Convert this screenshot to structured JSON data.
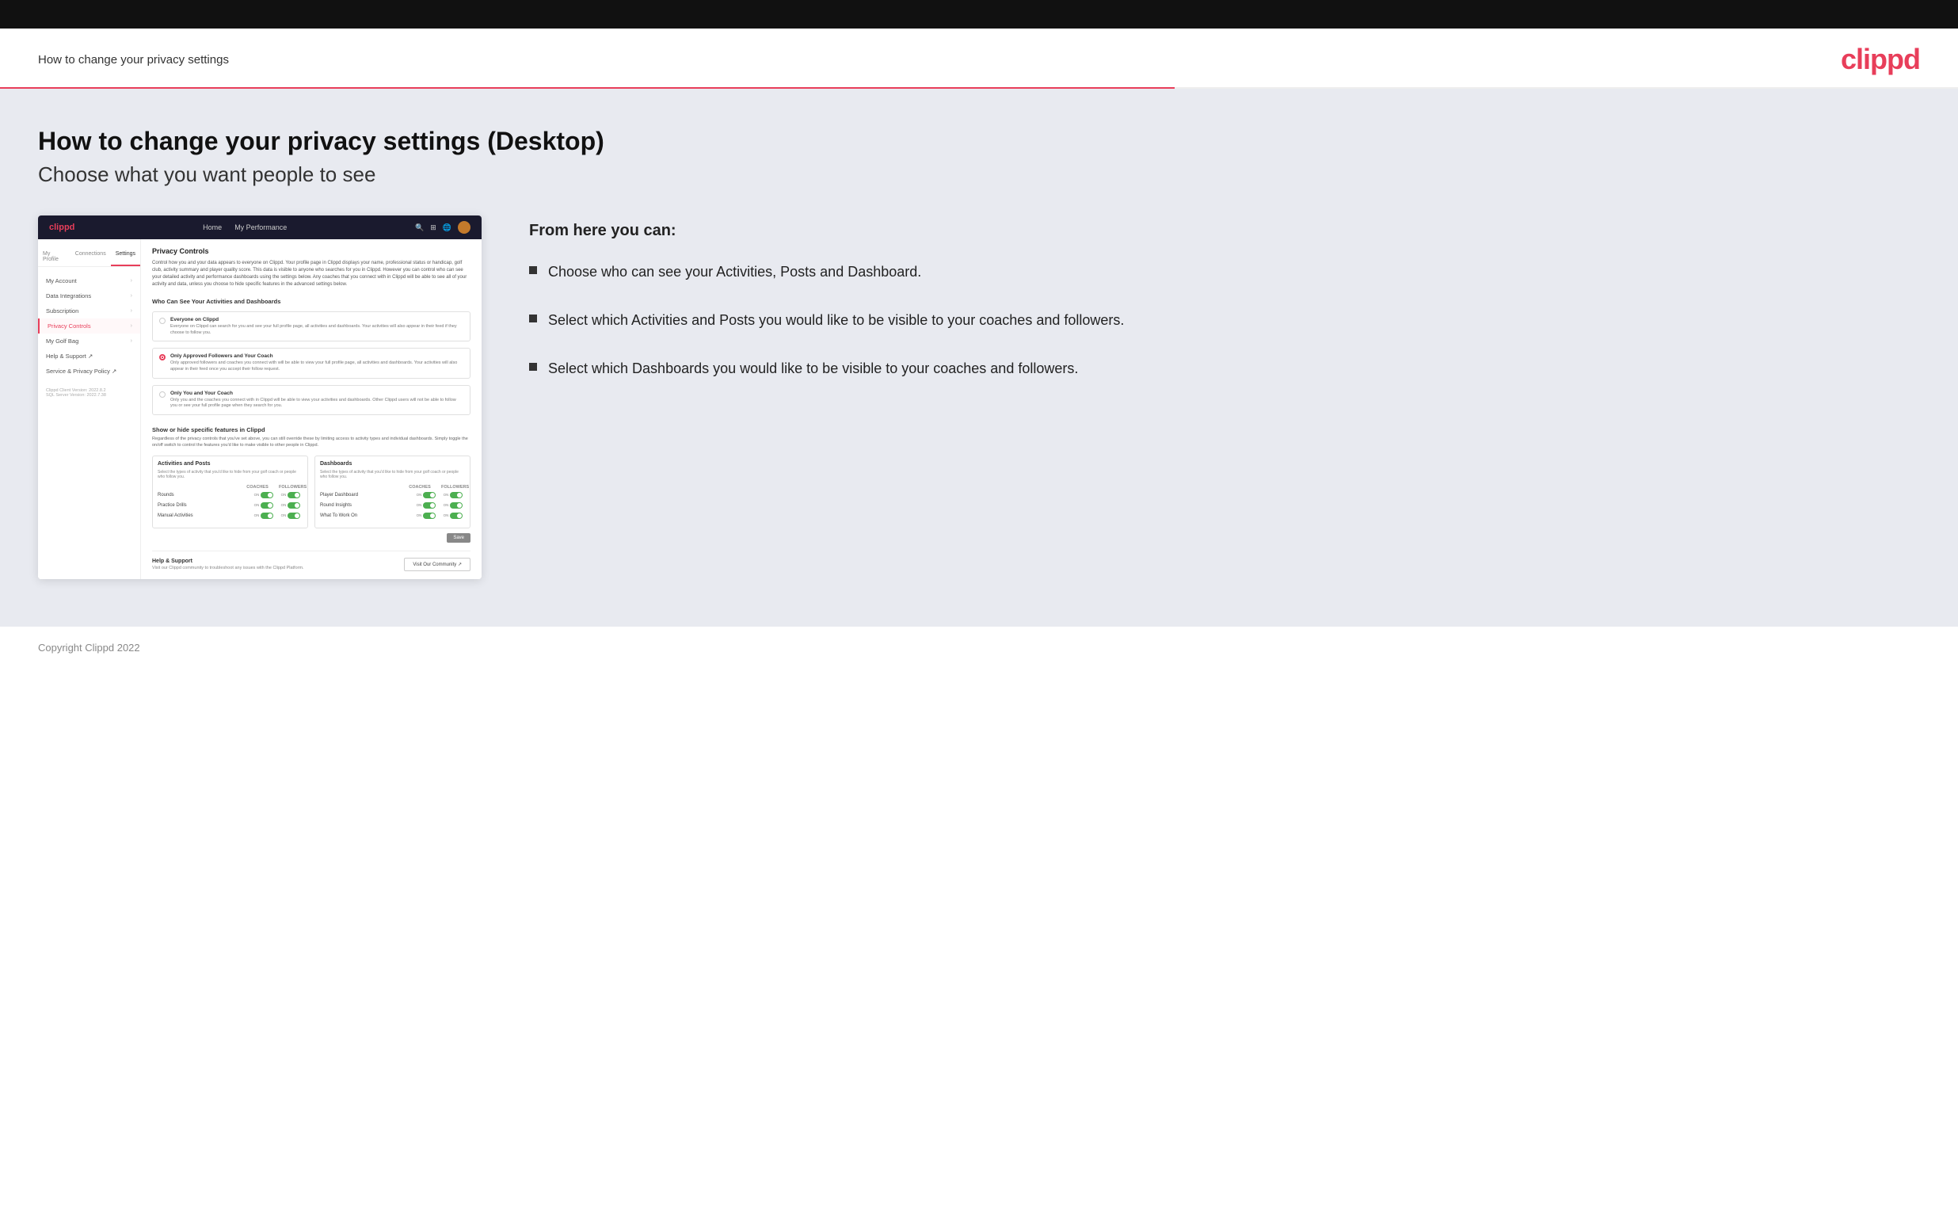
{
  "header": {
    "title": "How to change your privacy settings",
    "logo": "clippd"
  },
  "page": {
    "heading": "How to change your privacy settings (Desktop)",
    "subheading": "Choose what you want people to see"
  },
  "right_panel": {
    "from_here_label": "From here you can:",
    "bullets": [
      "Choose who can see your Activities, Posts and Dashboard.",
      "Select which Activities and Posts you would like to be visible to your coaches and followers.",
      "Select which Dashboards you would like to be visible to your coaches and followers."
    ]
  },
  "mockup": {
    "nav": {
      "logo": "clippd",
      "links": [
        "Home",
        "My Performance"
      ],
      "icons": [
        "search",
        "grid",
        "globe",
        "avatar"
      ]
    },
    "sidebar": {
      "tabs": [
        "My Profile",
        "Connections",
        "Settings"
      ],
      "items": [
        {
          "label": "My Account",
          "active": false
        },
        {
          "label": "Data Integrations",
          "active": false
        },
        {
          "label": "Subscription",
          "active": false
        },
        {
          "label": "Privacy Controls",
          "active": true
        },
        {
          "label": "My Golf Bag",
          "active": false
        },
        {
          "label": "Help & Support ↗",
          "active": false
        },
        {
          "label": "Service & Privacy Policy ↗",
          "active": false
        }
      ],
      "version": "Clippd Client Version: 2022.8.2\nSQL Server Version: 2022.7.38"
    },
    "main": {
      "section_title": "Privacy Controls",
      "description": "Control how you and your data appears to everyone on Clippd. Your profile page in Clippd displays your name, professional status or handicap, golf club, activity summary and player quality score. This data is visible to anyone who searches for you in Clippd. However you can control who can see your detailed activity and performance dashboards using the settings below. Any coaches that you connect with in Clippd will be able to see all of your activity and data, unless you choose to hide specific features in the advanced settings below.",
      "who_can_see_title": "Who Can See Your Activities and Dashboards",
      "radio_options": [
        {
          "label": "Everyone on Clippd",
          "description": "Everyone on Clippd can search for you and see your full profile page, all activities and dashboards. Your activities will also appear in their feed if they choose to follow you.",
          "selected": false
        },
        {
          "label": "Only Approved Followers and Your Coach",
          "description": "Only approved followers and coaches you connect with will be able to view your full profile page, all activities and dashboards. Your activities will also appear in their feed once you accept their follow request.",
          "selected": true
        },
        {
          "label": "Only You and Your Coach",
          "description": "Only you and the coaches you connect with in Clippd will be able to view your activities and dashboards. Other Clippd users will not be able to follow you or see your full profile page when they search for you.",
          "selected": false
        }
      ],
      "show_hide_title": "Show or hide specific features in Clippd",
      "show_hide_desc": "Regardless of the privacy controls that you've set above, you can still override these by limiting access to activity types and individual dashboards. Simply toggle the on/off switch to control the features you'd like to make visible to other people in Clippd.",
      "activities_panel": {
        "title": "Activities and Posts",
        "desc": "Select the types of activity that you'd like to hide from your golf coach or people who follow you.",
        "rows": [
          {
            "name": "Rounds",
            "coaches_on": true,
            "followers_on": true
          },
          {
            "name": "Practice Drills",
            "coaches_on": true,
            "followers_on": true
          },
          {
            "name": "Manual Activities",
            "coaches_on": true,
            "followers_on": true
          }
        ]
      },
      "dashboards_panel": {
        "title": "Dashboards",
        "desc": "Select the types of activity that you'd like to hide from your golf coach or people who follow you.",
        "rows": [
          {
            "name": "Player Dashboard",
            "coaches_on": true,
            "followers_on": true
          },
          {
            "name": "Round Insights",
            "coaches_on": true,
            "followers_on": true
          },
          {
            "name": "What To Work On",
            "coaches_on": true,
            "followers_on": true
          }
        ]
      },
      "save_label": "Save",
      "help_section": {
        "title": "Help & Support",
        "desc": "Visit our Clippd community to troubleshoot any issues with the Clippd Platform.",
        "visit_label": "Visit Our Community ↗"
      }
    }
  },
  "footer": {
    "copyright": "Copyright Clippd 2022"
  }
}
